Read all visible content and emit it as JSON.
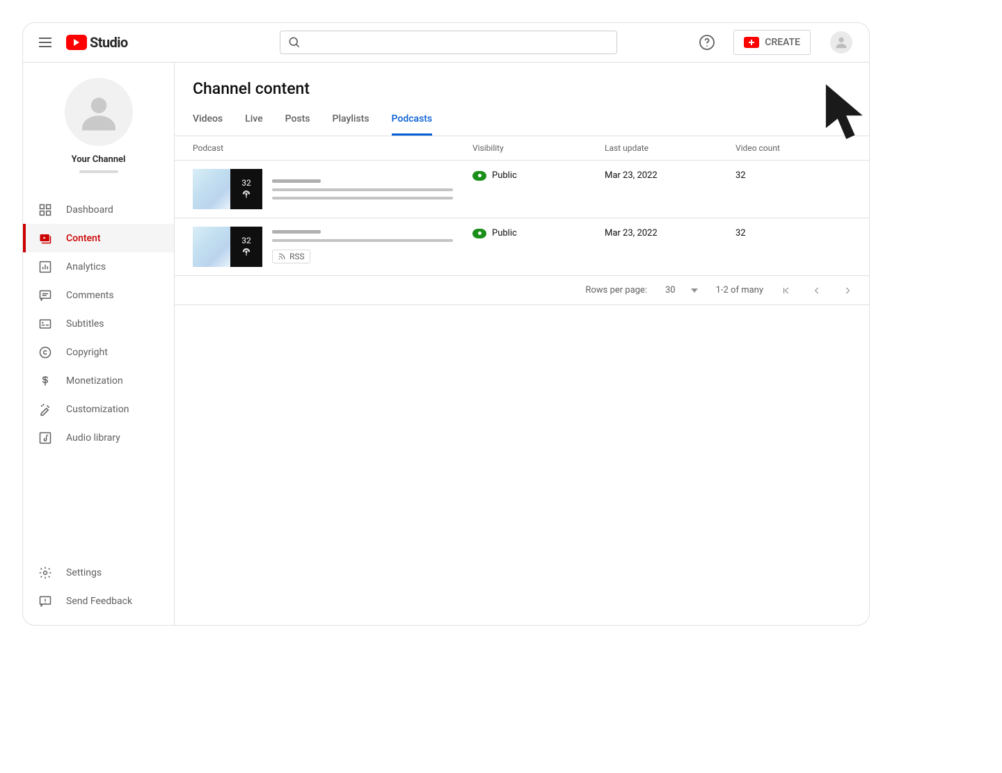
{
  "colors": {
    "accent_red": "#ff0000",
    "link_blue": "#065fd4",
    "active_red": "#cc0000",
    "public_green": "#1a8f1a"
  },
  "header": {
    "logo_text": "Studio",
    "search_placeholder": "",
    "create_label": "CREATE"
  },
  "sidebar": {
    "channel_name": "Your Channel",
    "items": [
      {
        "label": "Dashboard",
        "icon": "dashboard-icon"
      },
      {
        "label": "Content",
        "icon": "content-icon"
      },
      {
        "label": "Analytics",
        "icon": "analytics-icon"
      },
      {
        "label": "Comments",
        "icon": "comments-icon"
      },
      {
        "label": "Subtitles",
        "icon": "subtitles-icon"
      },
      {
        "label": "Copyright",
        "icon": "copyright-icon"
      },
      {
        "label": "Monetization",
        "icon": "monetization-icon"
      },
      {
        "label": "Customization",
        "icon": "customization-icon"
      },
      {
        "label": "Audio library",
        "icon": "audio-library-icon"
      }
    ],
    "bottom": [
      {
        "label": "Settings",
        "icon": "settings-icon"
      },
      {
        "label": "Send Feedback",
        "icon": "feedback-icon"
      }
    ],
    "active_index": 1
  },
  "main": {
    "title": "Channel content",
    "tabs": [
      "Videos",
      "Live",
      "Posts",
      "Playlists",
      "Podcasts"
    ],
    "active_tab_index": 4,
    "columns": {
      "podcast": "Podcast",
      "visibility": "Visibility",
      "last_update": "Last update",
      "video_count": "Video count"
    },
    "rows": [
      {
        "thumb_count": "32",
        "visibility": "Public",
        "last_update": "Mar 23, 2022",
        "video_count": "32",
        "has_rss": false
      },
      {
        "thumb_count": "32",
        "visibility": "Public",
        "last_update": "Mar 23, 2022",
        "video_count": "32",
        "has_rss": true,
        "rss_label": "RSS"
      }
    ],
    "pager": {
      "rows_per_page_label": "Rows per page:",
      "rows_per_page_value": "30",
      "range_text": "1-2 of many"
    }
  }
}
